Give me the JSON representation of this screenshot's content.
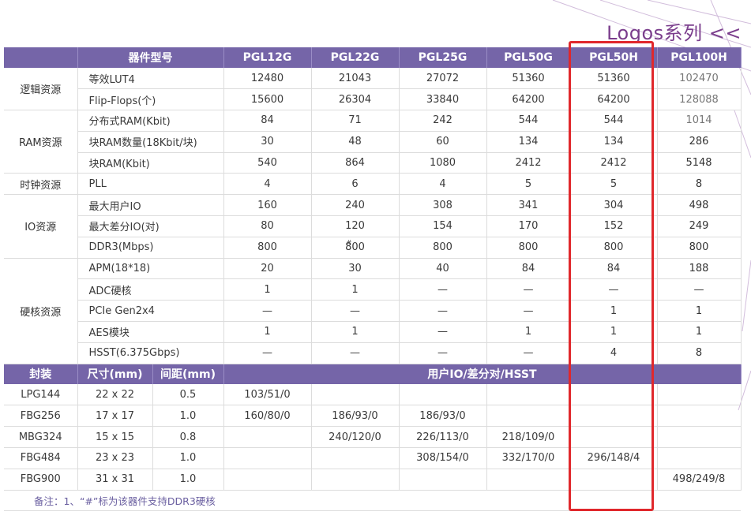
{
  "header": {
    "series_title": "Logos系列 <<"
  },
  "spec_table": {
    "header": [
      "器件型号",
      "PGL12G",
      "PGL22G",
      "PGL25G",
      "PGL50G",
      "PGL50H",
      "PGL100H"
    ],
    "groups": [
      {
        "category": "逻辑资源",
        "rows": [
          {
            "param": "等效LUT4",
            "values": [
              "12480",
              "21043",
              "27072",
              "51360",
              "51360",
              "102470"
            ]
          },
          {
            "param": "Flip-Flops(个)",
            "values": [
              "15600",
              "26304",
              "33840",
              "64200",
              "64200",
              "128088"
            ]
          }
        ]
      },
      {
        "category": "RAM资源",
        "rows": [
          {
            "param": "分布式RAM(Kbit)",
            "values": [
              "84",
              "71",
              "242",
              "544",
              "544",
              "1014"
            ]
          },
          {
            "param": "块RAM数量(18Kbit/块)",
            "values": [
              "30",
              "48",
              "60",
              "134",
              "134",
              "286"
            ]
          },
          {
            "param": "块RAM(Kbit)",
            "values": [
              "540",
              "864",
              "1080",
              "2412",
              "2412",
              "5148"
            ]
          }
        ]
      },
      {
        "category": "时钟资源",
        "rows": [
          {
            "param": "PLL",
            "values": [
              "4",
              "6",
              "4",
              "5",
              "5",
              "8"
            ]
          }
        ]
      },
      {
        "category": "IO资源",
        "rows": [
          {
            "param": "最大用户IO",
            "values": [
              "160",
              "240",
              "308",
              "341",
              "304",
              "498"
            ]
          },
          {
            "param": "最大差分IO(对)",
            "values": [
              "80",
              "120",
              "154",
              "170",
              "152",
              "249"
            ]
          },
          {
            "param": "DDR3(Mbps)",
            "values": [
              "800",
              "800",
              "800",
              "800",
              "800",
              "800"
            ]
          }
        ]
      },
      {
        "category": "硬核资源",
        "rows": [
          {
            "param": "APM(18*18)",
            "values": [
              "20",
              "30",
              "40",
              "84",
              "84",
              "188"
            ]
          },
          {
            "param": "ADC硬核",
            "values": [
              "1",
              "1",
              "—",
              "—",
              "—",
              "—"
            ]
          },
          {
            "param": "PCIe Gen2x4",
            "values": [
              "—",
              "—",
              "—",
              "—",
              "1",
              "1"
            ]
          },
          {
            "param": "AES模块",
            "values": [
              "1",
              "1",
              "—",
              "1",
              "1",
              "1"
            ]
          },
          {
            "param": "HSST(6.375Gbps)",
            "values": [
              "—",
              "—",
              "—",
              "—",
              "4",
              "8"
            ]
          }
        ]
      }
    ],
    "ddr3_hard_marker": "#"
  },
  "package_table": {
    "header": [
      "封装",
      "尺寸(mm)",
      "间距(mm)",
      "用户IO/差分对/HSST"
    ],
    "rows": [
      {
        "package": "LPG144",
        "size": "22 x 22",
        "pitch": "0.5",
        "values": [
          "103/51/0",
          "",
          "",
          "",
          "",
          ""
        ]
      },
      {
        "package": "FBG256",
        "size": "17 x 17",
        "pitch": "1.0",
        "values": [
          "160/80/0",
          "186/93/0",
          "186/93/0",
          "",
          "",
          ""
        ]
      },
      {
        "package": "MBG324",
        "size": "15 x 15",
        "pitch": "0.8",
        "values": [
          "",
          "240/120/0",
          "226/113/0",
          "218/109/0",
          "",
          ""
        ]
      },
      {
        "package": "FBG484",
        "size": "23 x 23",
        "pitch": "1.0",
        "values": [
          "",
          "",
          "308/154/0",
          "332/170/0",
          "296/148/4",
          ""
        ]
      },
      {
        "package": "FBG900",
        "size": "31 x 31",
        "pitch": "1.0",
        "values": [
          "",
          "",
          "",
          "",
          "",
          "498/249/8"
        ]
      }
    ]
  },
  "footnote": "备注：1、“#”标为该器件支持DDR3硬核",
  "colors": {
    "header_purple": "#7565a8",
    "title_purple": "#7a3d8c",
    "highlight_red": "#e0282c",
    "footnote_purple": "#6a5fa0"
  }
}
